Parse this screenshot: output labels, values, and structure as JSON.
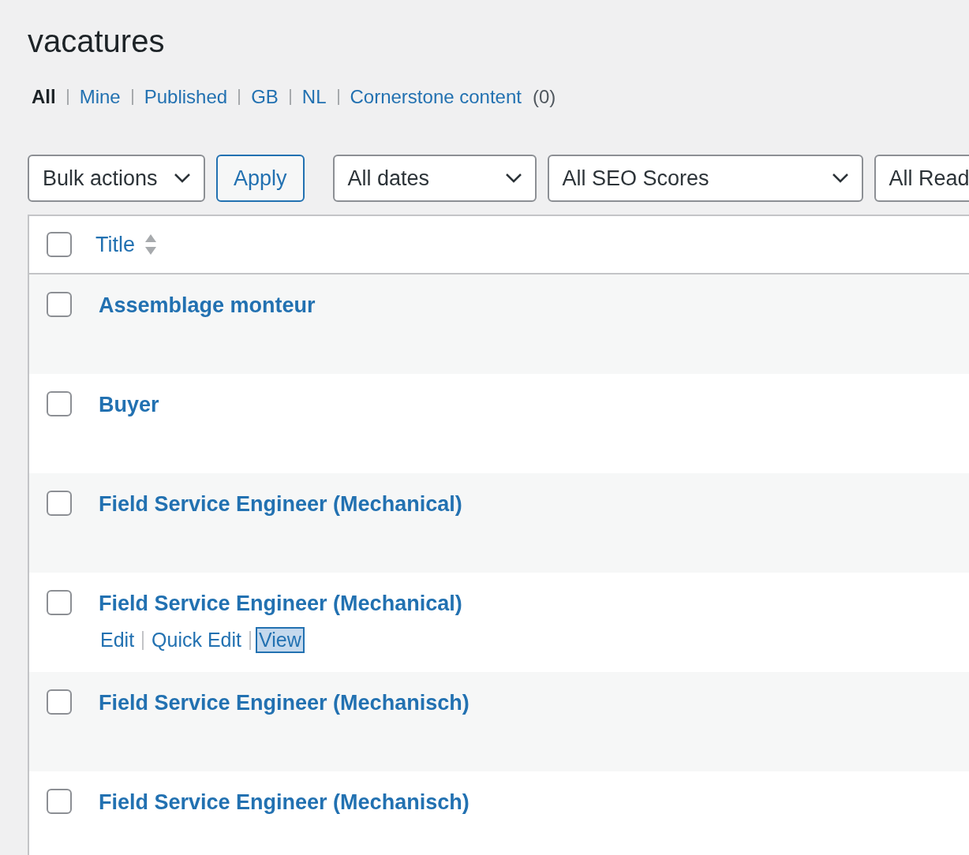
{
  "page_title": "vacatures",
  "views": [
    {
      "label": "All",
      "selected": true
    },
    {
      "label": "Mine",
      "selected": false
    },
    {
      "label": "Published",
      "selected": false
    },
    {
      "label": "GB",
      "selected": false
    },
    {
      "label": "NL",
      "selected": false
    },
    {
      "label": "Cornerstone content",
      "selected": false,
      "count": "(0)"
    }
  ],
  "bulk_actions": {
    "value": "Bulk actions"
  },
  "apply_button": "Apply",
  "filters": [
    {
      "value": "All dates"
    },
    {
      "value": "All SEO Scores"
    },
    {
      "value": "All Read"
    }
  ],
  "table": {
    "columns": [
      {
        "label": "Title",
        "checked": false
      }
    ],
    "rows": [
      {
        "title": "Assemblage monteur",
        "checked": false,
        "actions": []
      },
      {
        "title": "Buyer",
        "checked": false,
        "actions": []
      },
      {
        "title": "Field Service Engineer (Mechanical)",
        "checked": false,
        "actions": []
      },
      {
        "title": "Field Service Engineer (Mechanical)",
        "checked": false,
        "actions": [
          {
            "label": "Edit",
            "focused": false
          },
          {
            "label": "Quick Edit",
            "focused": false
          },
          {
            "label": "View",
            "focused": true
          }
        ]
      },
      {
        "title": "Field Service Engineer (Mechanisch)",
        "checked": false,
        "actions": []
      },
      {
        "title": "Field Service Engineer (Mechanisch)",
        "checked": false,
        "actions": []
      }
    ]
  }
}
